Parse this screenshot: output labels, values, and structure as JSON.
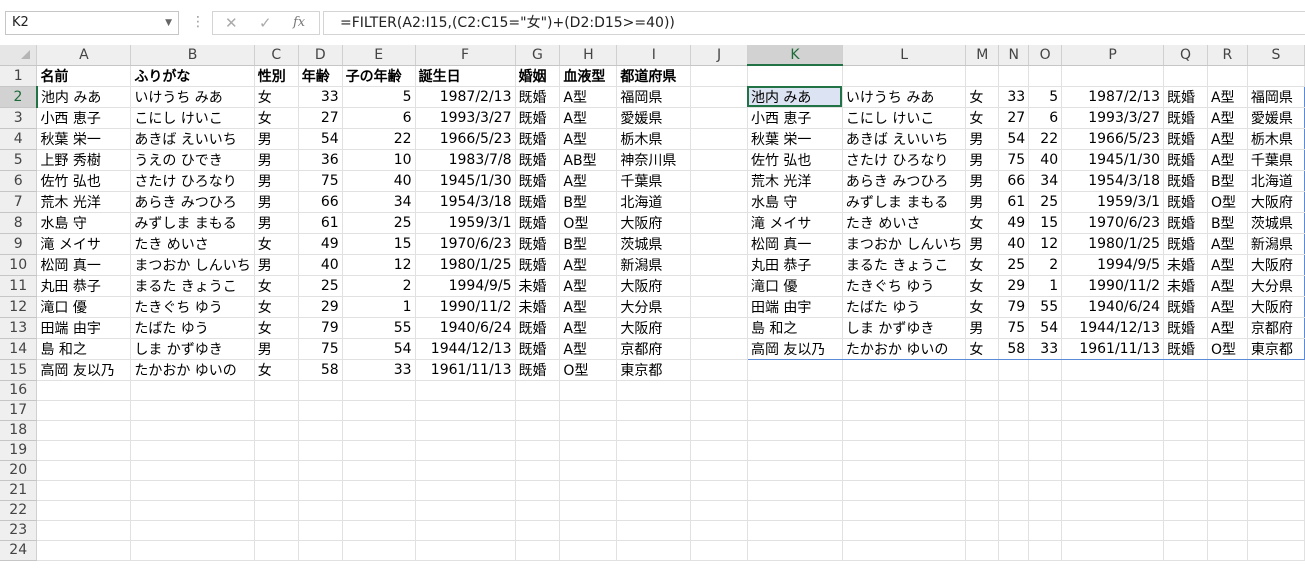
{
  "formula_bar": {
    "name_box": "K2",
    "formula": "=FILTER(A2:I15,(C2:C15=\"女\")+(D2:D15>=40))",
    "cancel_icon": "✕",
    "enter_icon": "✓",
    "fx_icon": "fx"
  },
  "columns": [
    "A",
    "B",
    "C",
    "D",
    "E",
    "F",
    "G",
    "H",
    "I",
    "J",
    "K",
    "L",
    "M",
    "N",
    "O",
    "P",
    "Q",
    "R",
    "S"
  ],
  "headers": [
    "名前",
    "ふりがな",
    "性別",
    "年齢",
    "子の年齢",
    "誕生日",
    "婚姻",
    "血液型",
    "都道府県"
  ],
  "source_rows": [
    [
      "池内 みあ",
      "いけうち みあ",
      "女",
      "33",
      "5",
      "1987/2/13",
      "既婚",
      "A型",
      "福岡県"
    ],
    [
      "小西 恵子",
      "こにし けいこ",
      "女",
      "27",
      "6",
      "1993/3/27",
      "既婚",
      "A型",
      "愛媛県"
    ],
    [
      "秋葉 栄一",
      "あきば えいいち",
      "男",
      "54",
      "22",
      "1966/5/23",
      "既婚",
      "A型",
      "栃木県"
    ],
    [
      "上野 秀樹",
      "うえの ひでき",
      "男",
      "36",
      "10",
      "1983/7/8",
      "既婚",
      "AB型",
      "神奈川県"
    ],
    [
      "佐竹 弘也",
      "さたけ ひろなり",
      "男",
      "75",
      "40",
      "1945/1/30",
      "既婚",
      "A型",
      "千葉県"
    ],
    [
      "荒木 光洋",
      "あらき みつひろ",
      "男",
      "66",
      "34",
      "1954/3/18",
      "既婚",
      "B型",
      "北海道"
    ],
    [
      "水島 守",
      "みずしま まもる",
      "男",
      "61",
      "25",
      "1959/3/1",
      "既婚",
      "O型",
      "大阪府"
    ],
    [
      "滝 メイサ",
      "たき めいさ",
      "女",
      "49",
      "15",
      "1970/6/23",
      "既婚",
      "B型",
      "茨城県"
    ],
    [
      "松岡 真一",
      "まつおか しんいち",
      "男",
      "40",
      "12",
      "1980/1/25",
      "既婚",
      "A型",
      "新潟県"
    ],
    [
      "丸田 恭子",
      "まるた きょうこ",
      "女",
      "25",
      "2",
      "1994/9/5",
      "未婚",
      "A型",
      "大阪府"
    ],
    [
      "滝口 優",
      "たきぐち ゆう",
      "女",
      "29",
      "1",
      "1990/11/2",
      "未婚",
      "A型",
      "大分県"
    ],
    [
      "田端 由宇",
      "たばた ゆう",
      "女",
      "79",
      "55",
      "1940/6/24",
      "既婚",
      "A型",
      "大阪府"
    ],
    [
      "島 和之",
      "しま かずゆき",
      "男",
      "75",
      "54",
      "1944/12/13",
      "既婚",
      "A型",
      "京都府"
    ],
    [
      "高岡 友以乃",
      "たかおか ゆいの",
      "女",
      "58",
      "33",
      "1961/11/13",
      "既婚",
      "O型",
      "東京都"
    ]
  ],
  "filtered_rows": [
    [
      "池内 みあ",
      "いけうち みあ",
      "女",
      "33",
      "5",
      "1987/2/13",
      "既婚",
      "A型",
      "福岡県"
    ],
    [
      "小西 恵子",
      "こにし けいこ",
      "女",
      "27",
      "6",
      "1993/3/27",
      "既婚",
      "A型",
      "愛媛県"
    ],
    [
      "秋葉 栄一",
      "あきば えいいち",
      "男",
      "54",
      "22",
      "1966/5/23",
      "既婚",
      "A型",
      "栃木県"
    ],
    [
      "佐竹 弘也",
      "さたけ ひろなり",
      "男",
      "75",
      "40",
      "1945/1/30",
      "既婚",
      "A型",
      "千葉県"
    ],
    [
      "荒木 光洋",
      "あらき みつひろ",
      "男",
      "66",
      "34",
      "1954/3/18",
      "既婚",
      "B型",
      "北海道"
    ],
    [
      "水島 守",
      "みずしま まもる",
      "男",
      "61",
      "25",
      "1959/3/1",
      "既婚",
      "O型",
      "大阪府"
    ],
    [
      "滝 メイサ",
      "たき めいさ",
      "女",
      "49",
      "15",
      "1970/6/23",
      "既婚",
      "B型",
      "茨城県"
    ],
    [
      "松岡 真一",
      "まつおか しんいち",
      "男",
      "40",
      "12",
      "1980/1/25",
      "既婚",
      "A型",
      "新潟県"
    ],
    [
      "丸田 恭子",
      "まるた きょうこ",
      "女",
      "25",
      "2",
      "1994/9/5",
      "未婚",
      "A型",
      "大阪府"
    ],
    [
      "滝口 優",
      "たきぐち ゆう",
      "女",
      "29",
      "1",
      "1990/11/2",
      "未婚",
      "A型",
      "大分県"
    ],
    [
      "田端 由宇",
      "たばた ゆう",
      "女",
      "79",
      "55",
      "1940/6/24",
      "既婚",
      "A型",
      "大阪府"
    ],
    [
      "島 和之",
      "しま かずゆき",
      "男",
      "75",
      "54",
      "1944/12/13",
      "既婚",
      "A型",
      "京都府"
    ],
    [
      "高岡 友以乃",
      "たかおか ゆいの",
      "女",
      "58",
      "33",
      "1961/11/13",
      "既婚",
      "O型",
      "東京都"
    ]
  ],
  "row_count": 24,
  "active_cell": "K2",
  "colors": {
    "accent": "#217346",
    "spill_border": "#5b8bd6",
    "active_fill": "#dce3f2"
  }
}
